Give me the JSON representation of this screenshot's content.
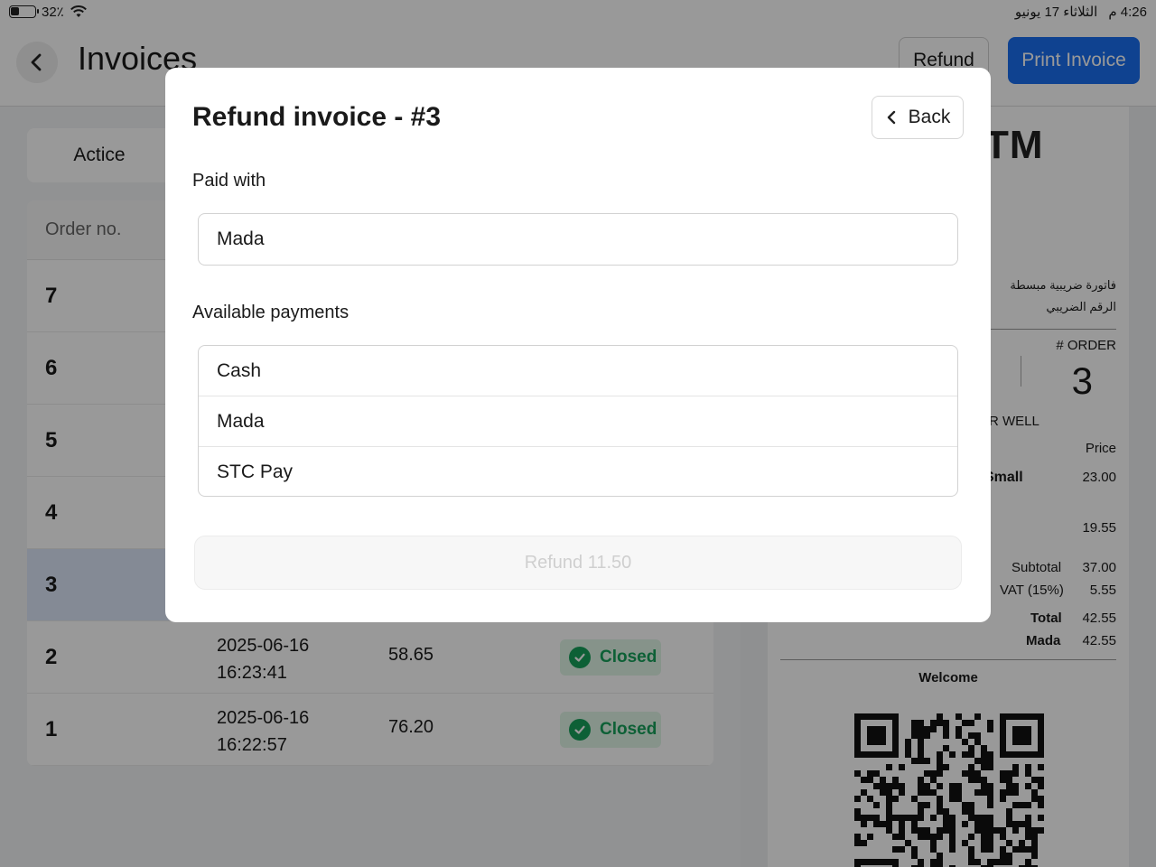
{
  "status_bar": {
    "battery": "32٪",
    "time": "4:26 م",
    "date": "الثلاثاء 17 يونيو"
  },
  "header": {
    "title": "Invoices",
    "refund_label": "Refund",
    "print_label": "Print Invoice"
  },
  "tabs": {
    "active_label": "Actice"
  },
  "list": {
    "column_order": "Order no.",
    "rows": [
      {
        "num": "7",
        "date": "",
        "time": "",
        "amount": "",
        "status": ""
      },
      {
        "num": "6",
        "date": "",
        "time": "",
        "amount": "",
        "status": ""
      },
      {
        "num": "5",
        "date": "",
        "time": "",
        "amount": "",
        "status": ""
      },
      {
        "num": "4",
        "date": "",
        "time": "",
        "amount": "",
        "status": ""
      },
      {
        "num": "3",
        "date": "",
        "time": "",
        "amount": "",
        "status": ""
      },
      {
        "num": "2",
        "date": "2025-06-16",
        "time": "16:23:41",
        "amount": "58.65",
        "status": "Closed"
      },
      {
        "num": "1",
        "date": "2025-06-16",
        "time": "16:22:57",
        "amount": "76.20",
        "status": "Closed"
      }
    ]
  },
  "receipt": {
    "logo": "TM",
    "simplified_tax_invoice": "فاتورة ضريبية مبسطة",
    "tax_number": "الرقم الضريبي",
    "order_label": "# ORDER",
    "order_number": "3",
    "well_text": "ER WELL",
    "price_header": "Price",
    "item_small": "Small",
    "item_small_price": "23.00",
    "item_2_price": "19.55",
    "subtotal_label": "Subtotal",
    "subtotal": "37.00",
    "vat_label": "VAT (15%)",
    "vat": "5.55",
    "total_label": "Total",
    "total": "42.55",
    "mada_label": "Mada",
    "mada": "42.55",
    "welcome": "Welcome"
  },
  "modal": {
    "title": "Refund invoice - #3",
    "back_label": "Back",
    "paid_with_label": "Paid with",
    "paid_with_value": "Mada",
    "available_label": "Available payments",
    "payments": [
      "Cash",
      "Mada",
      "STC Pay"
    ],
    "refund_button": "Refund 11.50"
  },
  "colors": {
    "primary": "#1a6ef0",
    "closed_green": "#17a05a",
    "closed_bg": "#dff5e6",
    "selected_row": "#dce6f8"
  }
}
